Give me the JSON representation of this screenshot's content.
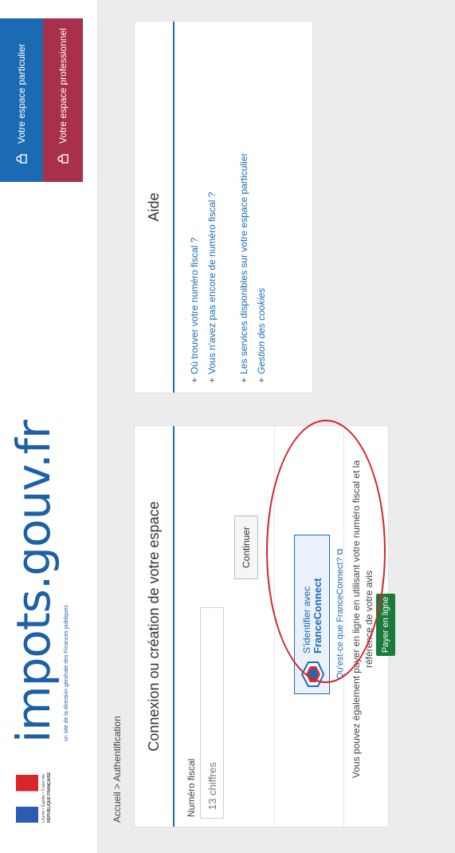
{
  "header": {
    "marianne_line1": "Liberté • Égalité • Fraternité",
    "marianne_line2": "RÉPUBLIQUE FRANÇAISE",
    "logo": "impots.gouv.fr",
    "tagline": "un site de la direction générale des Finances publiques",
    "btn_particulier": "Votre espace particulier",
    "btn_professionnel": "Votre espace professionnel"
  },
  "breadcrumb": "Accueil > Authentification",
  "login": {
    "title": "Connexion ou création de votre espace",
    "field_label": "Numéro fiscal",
    "field_placeholder": "13 chiffres",
    "continue_label": "Continuer",
    "fc_line1": "S'identifier avec",
    "fc_line2": "FranceConnect",
    "fc_link": "Qu'est-ce que FranceConnect? ⧉",
    "pay_text": "Vous pouvez également payer en ligne en utilisant votre numéro fiscal et la référence de votre avis",
    "pay_button": "Payer en ligne"
  },
  "aide": {
    "title": "Aide",
    "links": [
      "Où trouver votre numéro fiscal ?",
      "Vous n'avez pas encore de numéro fiscal ?",
      "Les services disponibles sur votre espace particulier",
      "Gestion des cookies"
    ]
  },
  "colors": {
    "blue": "#1b6bb4",
    "pro": "#a8304a",
    "pay": "#1a7b3c",
    "annotation": "#d4232b"
  }
}
